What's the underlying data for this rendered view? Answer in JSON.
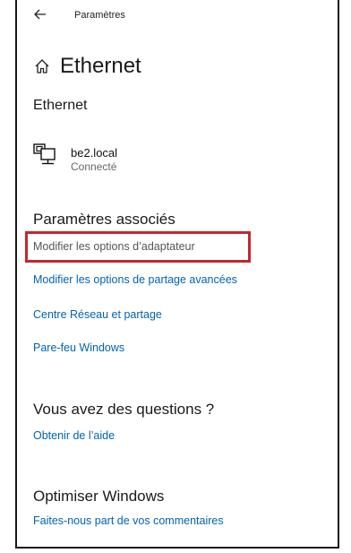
{
  "window": {
    "title": "Paramètres",
    "back_icon": "arrow-left-icon"
  },
  "header": {
    "home_icon": "home-icon",
    "title": "Ethernet"
  },
  "ethernet_section": {
    "title": "Ethernet",
    "network": {
      "icon": "network-computer-icon",
      "name": "be2.local",
      "status": "Connecté"
    }
  },
  "related_settings": {
    "title": "Paramètres associés",
    "links": [
      "Modifier les options d’adaptateur",
      "Modifier les options de partage avancées",
      "Centre Réseau et partage",
      "Pare-feu Windows"
    ],
    "highlight_color": "#c4262e"
  },
  "questions": {
    "title": "Vous avez des questions ?",
    "link": "Obtenir de l’aide"
  },
  "optimize": {
    "title": "Optimiser Windows",
    "link": "Faites-nous part de vos commentaires"
  },
  "colors": {
    "link": "#0063b1",
    "text": "#1a1a1a",
    "muted": "#666666"
  }
}
